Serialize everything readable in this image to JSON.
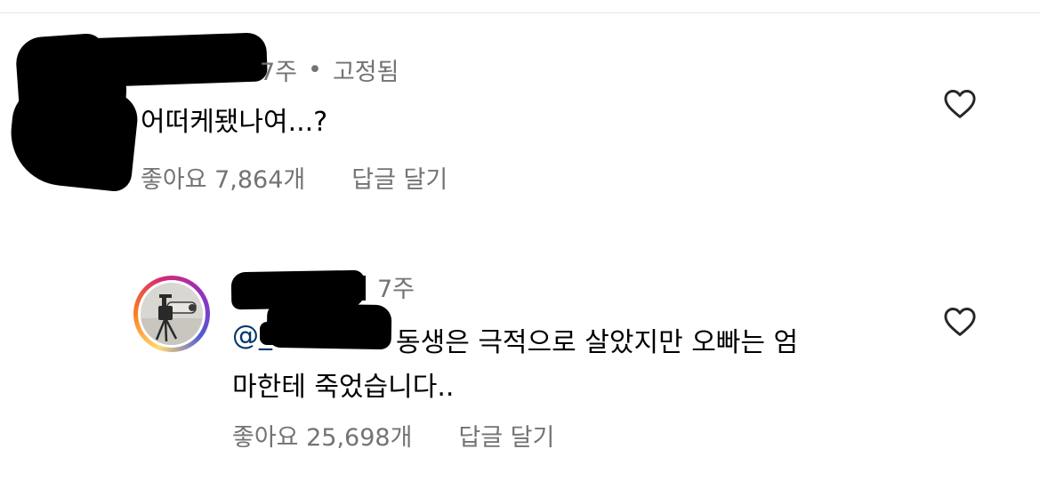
{
  "comments": [
    {
      "time": "7주",
      "pinned_label": "고정됨",
      "text": "어떠케됐나여...?",
      "likes_label": "좋아요 7,864개",
      "reply_label": "답글 달기"
    },
    {
      "time": "7주",
      "mention": "@_",
      "text_line1": "동생은 극적으로 살았지만 오빠는 엄",
      "text_line2": "마한테 죽었습니다..",
      "likes_label": "좋아요 25,698개",
      "reply_label": "답글 달기"
    }
  ],
  "icons": {
    "like": "heart-outline-icon",
    "avatar_story_ring": "instagram-gradient-ring"
  },
  "colors": {
    "secondary_text": "#737373",
    "mention": "#00376b",
    "primary_text": "#000000"
  }
}
